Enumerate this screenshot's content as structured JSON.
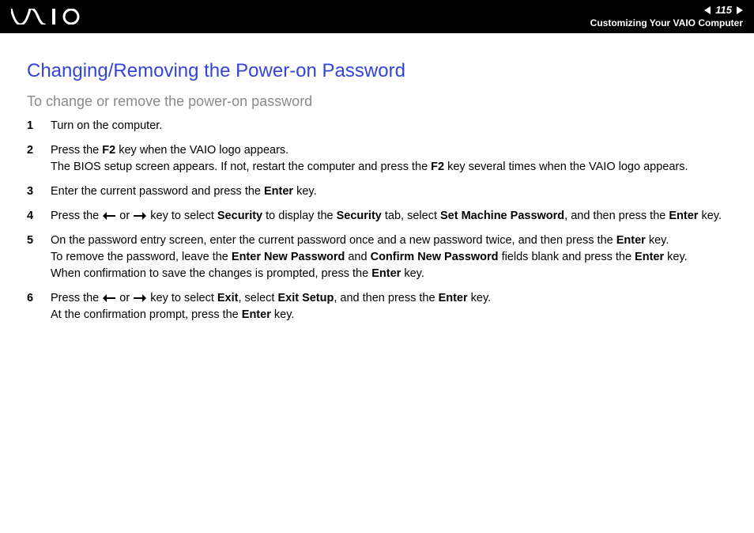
{
  "header": {
    "page_number": "115",
    "section": "Customizing Your VAIO Computer"
  },
  "title": "Changing/Removing the Power-on Password",
  "subtitle": "To change or remove the power-on password",
  "steps": [
    {
      "num": "1",
      "parts": [
        {
          "t": "Turn on the computer."
        }
      ]
    },
    {
      "num": "2",
      "parts": [
        {
          "t": "Press the "
        },
        {
          "t": "F2",
          "b": true
        },
        {
          "t": " key when the VAIO logo appears."
        },
        {
          "br": true
        },
        {
          "t": "The BIOS setup screen appears. If not, restart the computer and press the "
        },
        {
          "t": "F2",
          "b": true
        },
        {
          "t": " key several times when the VAIO logo appears."
        }
      ]
    },
    {
      "num": "3",
      "parts": [
        {
          "t": "Enter the current password and press the "
        },
        {
          "t": "Enter",
          "b": true
        },
        {
          "t": " key."
        }
      ]
    },
    {
      "num": "4",
      "parts": [
        {
          "t": "Press the "
        },
        {
          "arrow": "left"
        },
        {
          "t": " or "
        },
        {
          "arrow": "right"
        },
        {
          "t": " key to select "
        },
        {
          "t": "Security",
          "b": true
        },
        {
          "t": " to display the "
        },
        {
          "t": "Security",
          "b": true
        },
        {
          "t": " tab, select "
        },
        {
          "t": "Set Machine Password",
          "b": true
        },
        {
          "t": ", and then press the "
        },
        {
          "t": "Enter",
          "b": true
        },
        {
          "t": " key."
        }
      ]
    },
    {
      "num": "5",
      "parts": [
        {
          "t": "On the password entry screen, enter the current password once and a new password twice, and then press the "
        },
        {
          "t": "Enter",
          "b": true
        },
        {
          "t": " key."
        },
        {
          "br": true
        },
        {
          "t": "To remove the password, leave the "
        },
        {
          "t": "Enter New Password",
          "b": true
        },
        {
          "t": " and "
        },
        {
          "t": "Confirm New Password",
          "b": true
        },
        {
          "t": " fields blank and press the "
        },
        {
          "t": "Enter",
          "b": true
        },
        {
          "t": " key."
        },
        {
          "br": true
        },
        {
          "t": "When confirmation to save the changes is prompted, press the "
        },
        {
          "t": "Enter",
          "b": true
        },
        {
          "t": " key."
        }
      ]
    },
    {
      "num": "6",
      "parts": [
        {
          "t": "Press the "
        },
        {
          "arrow": "left"
        },
        {
          "t": " or "
        },
        {
          "arrow": "right"
        },
        {
          "t": " key to select "
        },
        {
          "t": "Exit",
          "b": true
        },
        {
          "t": ", select "
        },
        {
          "t": "Exit Setup",
          "b": true
        },
        {
          "t": ", and then press the "
        },
        {
          "t": "Enter",
          "b": true
        },
        {
          "t": " key."
        },
        {
          "br": true
        },
        {
          "t": "At the confirmation prompt, press the "
        },
        {
          "t": "Enter",
          "b": true
        },
        {
          "t": " key."
        }
      ]
    }
  ]
}
